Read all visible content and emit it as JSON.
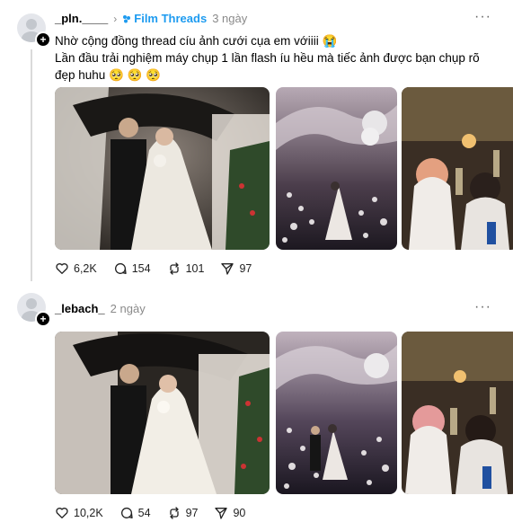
{
  "posts": [
    {
      "username": "_pln.____",
      "community": "Film Threads",
      "time": "3 ngày",
      "line1": "Nhờ cộng đồng thread cíu ảnh cưới cụa em vớiiii 😭",
      "line2": "Lần đầu trải nghiệm máy chụp 1 lần flash íu hều mà tiếc ảnh được bạn chụp rõ",
      "line3": "đẹp huhu 🥺 🥺 🥺",
      "likes": "6,2K",
      "comments": "154",
      "reposts": "101",
      "shares": "97"
    },
    {
      "username": "_lebach_",
      "time": "2 ngày",
      "likes": "10,2K",
      "comments": "54",
      "reposts": "97",
      "shares": "90"
    }
  ],
  "colors": {
    "community": "#1d9bf0",
    "thread_line": "#dadada"
  },
  "icons": [
    "avatar-default-icon",
    "follow-plus-icon",
    "chevron-right-icon",
    "community-icon",
    "more-icon",
    "heart-icon",
    "comment-icon",
    "repost-icon",
    "share-icon"
  ]
}
